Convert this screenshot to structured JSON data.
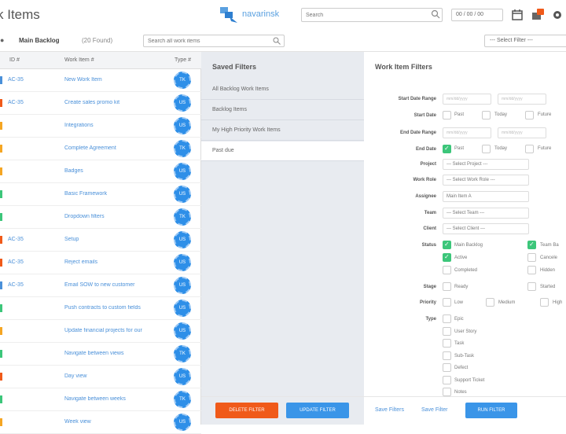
{
  "header": {
    "title": "k Items",
    "logo_text": "navarinsk",
    "search_placeholder": "Search",
    "date_value": "00 / 00 / 00"
  },
  "subbar": {
    "board_name": "Main Backlog",
    "board_count": "(20 Found)",
    "search_placeholder": "Search all work items",
    "filter_select": "--- Select Filter ---"
  },
  "table": {
    "headers": {
      "id": "ID #",
      "name": "Work Item #",
      "type": "Type #"
    },
    "rows": [
      {
        "id": "AC-35",
        "name": "New Work Item",
        "badge": "TK",
        "bar": "#4a90d9"
      },
      {
        "id": "AC-35",
        "name": "Create sales promo kit",
        "badge": "US",
        "bar": "#f05a1a"
      },
      {
        "id": "",
        "name": "Integrations",
        "badge": "US",
        "bar": "#f5a623"
      },
      {
        "id": "",
        "name": "Complete Agreement",
        "badge": "TK",
        "bar": "#f5a623"
      },
      {
        "id": "",
        "name": "Badges",
        "badge": "US",
        "bar": "#f5a623"
      },
      {
        "id": "",
        "name": "Basic Framework",
        "badge": "US",
        "bar": "#3cc67a"
      },
      {
        "id": "",
        "name": "Dropdown filters",
        "badge": "TK",
        "bar": "#3cc67a"
      },
      {
        "id": "AC-35",
        "name": "Setup",
        "badge": "US",
        "bar": "#f05a1a"
      },
      {
        "id": "AC-35",
        "name": "Reject emails",
        "badge": "US",
        "bar": "#f05a1a"
      },
      {
        "id": "AC-35",
        "name": "Email SOW to new customer",
        "badge": "US",
        "bar": "#4a90d9"
      },
      {
        "id": "",
        "name": "Push contracts to custom fields",
        "badge": "US",
        "bar": "#3cc67a"
      },
      {
        "id": "",
        "name": "Update financial projects for our",
        "badge": "US",
        "bar": "#f5a623"
      },
      {
        "id": "",
        "name": "Navigate between views",
        "badge": "TK",
        "bar": "#3cc67a"
      },
      {
        "id": "",
        "name": "Day view",
        "badge": "US",
        "bar": "#f05a1a"
      },
      {
        "id": "",
        "name": "Navigate between weeks",
        "badge": "TK",
        "bar": "#3cc67a"
      },
      {
        "id": "",
        "name": "Week view",
        "badge": "US",
        "bar": "#f5a623"
      }
    ]
  },
  "saved_filters": {
    "title": "Saved Filters",
    "items": [
      {
        "label": "All Backlog Work Items",
        "active": false
      },
      {
        "label": "Backlog Items",
        "active": false
      },
      {
        "label": "My High Priority Work Items",
        "active": false
      },
      {
        "label": "Past due",
        "active": true
      }
    ],
    "delete_label": "DELETE FILTER",
    "update_label": "UPDATE FILTER"
  },
  "filters": {
    "title": "Work Item Filters",
    "start_date_range": {
      "label": "Start Date Range",
      "from": "mm/dd/yyyy",
      "to": "mm/dd/yyyy"
    },
    "start_date": {
      "label": "Start Date",
      "options": [
        "Past",
        "Today",
        "Future"
      ],
      "checked": [
        false,
        false,
        false
      ]
    },
    "end_date_range": {
      "label": "End Date Range",
      "from": "mm/dd/yyyy",
      "to": "mm/dd/yyyy"
    },
    "end_date": {
      "label": "End Date",
      "options": [
        "Past",
        "Today",
        "Future"
      ],
      "checked": [
        true,
        false,
        false
      ]
    },
    "project": {
      "label": "Project",
      "value": "--- Select Project ---"
    },
    "work_role": {
      "label": "Work Role",
      "value": "--- Select Work Role ---"
    },
    "assignee": {
      "label": "Assignee",
      "value": "Main Item A"
    },
    "team": {
      "label": "Team",
      "value": "--- Select Team ---"
    },
    "client": {
      "label": "Client",
      "value": "--- Select Client ---"
    },
    "status": {
      "label": "Status",
      "col1": [
        {
          "label": "Main Backlog",
          "checked": true
        },
        {
          "label": "Active",
          "checked": true
        },
        {
          "label": "Completed",
          "checked": false
        }
      ],
      "col2": [
        {
          "label": "Team Ba",
          "checked": true
        },
        {
          "label": "Cancele",
          "checked": false
        },
        {
          "label": "Hidden",
          "checked": false
        }
      ]
    },
    "stage": {
      "label": "Stage",
      "options": [
        "Ready",
        "Started"
      ],
      "checked": [
        false,
        false
      ]
    },
    "priority": {
      "label": "Priority",
      "options": [
        "Low",
        "Medium",
        "High"
      ],
      "checked": [
        false,
        false,
        false
      ]
    },
    "type": {
      "label": "Type",
      "options": [
        "Epic",
        "User Story",
        "Task",
        "Sub-Task",
        "Defect",
        "Support Ticket",
        "Notes"
      ],
      "checked": [
        false,
        false,
        false,
        false,
        false,
        false,
        false
      ]
    },
    "save_filters_label": "Save Filters",
    "save_filter_label": "Save Filter",
    "run_label": "RUN FILTER"
  },
  "colors": {
    "accent": "#3a95e8",
    "danger": "#f05a1a",
    "success": "#3cc67a"
  }
}
